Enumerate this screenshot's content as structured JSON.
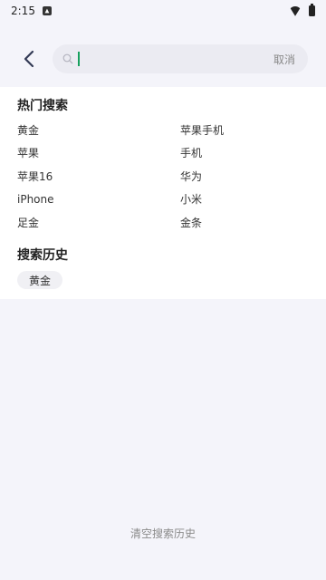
{
  "status_bar": {
    "time": "2:15",
    "icons": [
      "notification-app-icon",
      "wifi-icon",
      "battery-icon"
    ]
  },
  "header": {
    "back_icon": "chevron-left-icon",
    "search": {
      "icon": "search-icon",
      "value": "",
      "placeholder": ""
    },
    "cancel_label": "取消"
  },
  "hot_search": {
    "title": "热门搜索",
    "items": [
      "黄金",
      "苹果手机",
      "苹果",
      "手机",
      "苹果16",
      "华为",
      "iPhone",
      "小米",
      "足金",
      "金条"
    ]
  },
  "search_history": {
    "title": "搜索历史",
    "items": [
      "黄金"
    ]
  },
  "clear_history_label": "清空搜索历史",
  "colors": {
    "page_background": "#f4f4fa",
    "card_background": "#ffffff",
    "search_box": "#ebebf2",
    "caret_accent": "#17a05e",
    "secondary_text": "#8a8a8a"
  }
}
